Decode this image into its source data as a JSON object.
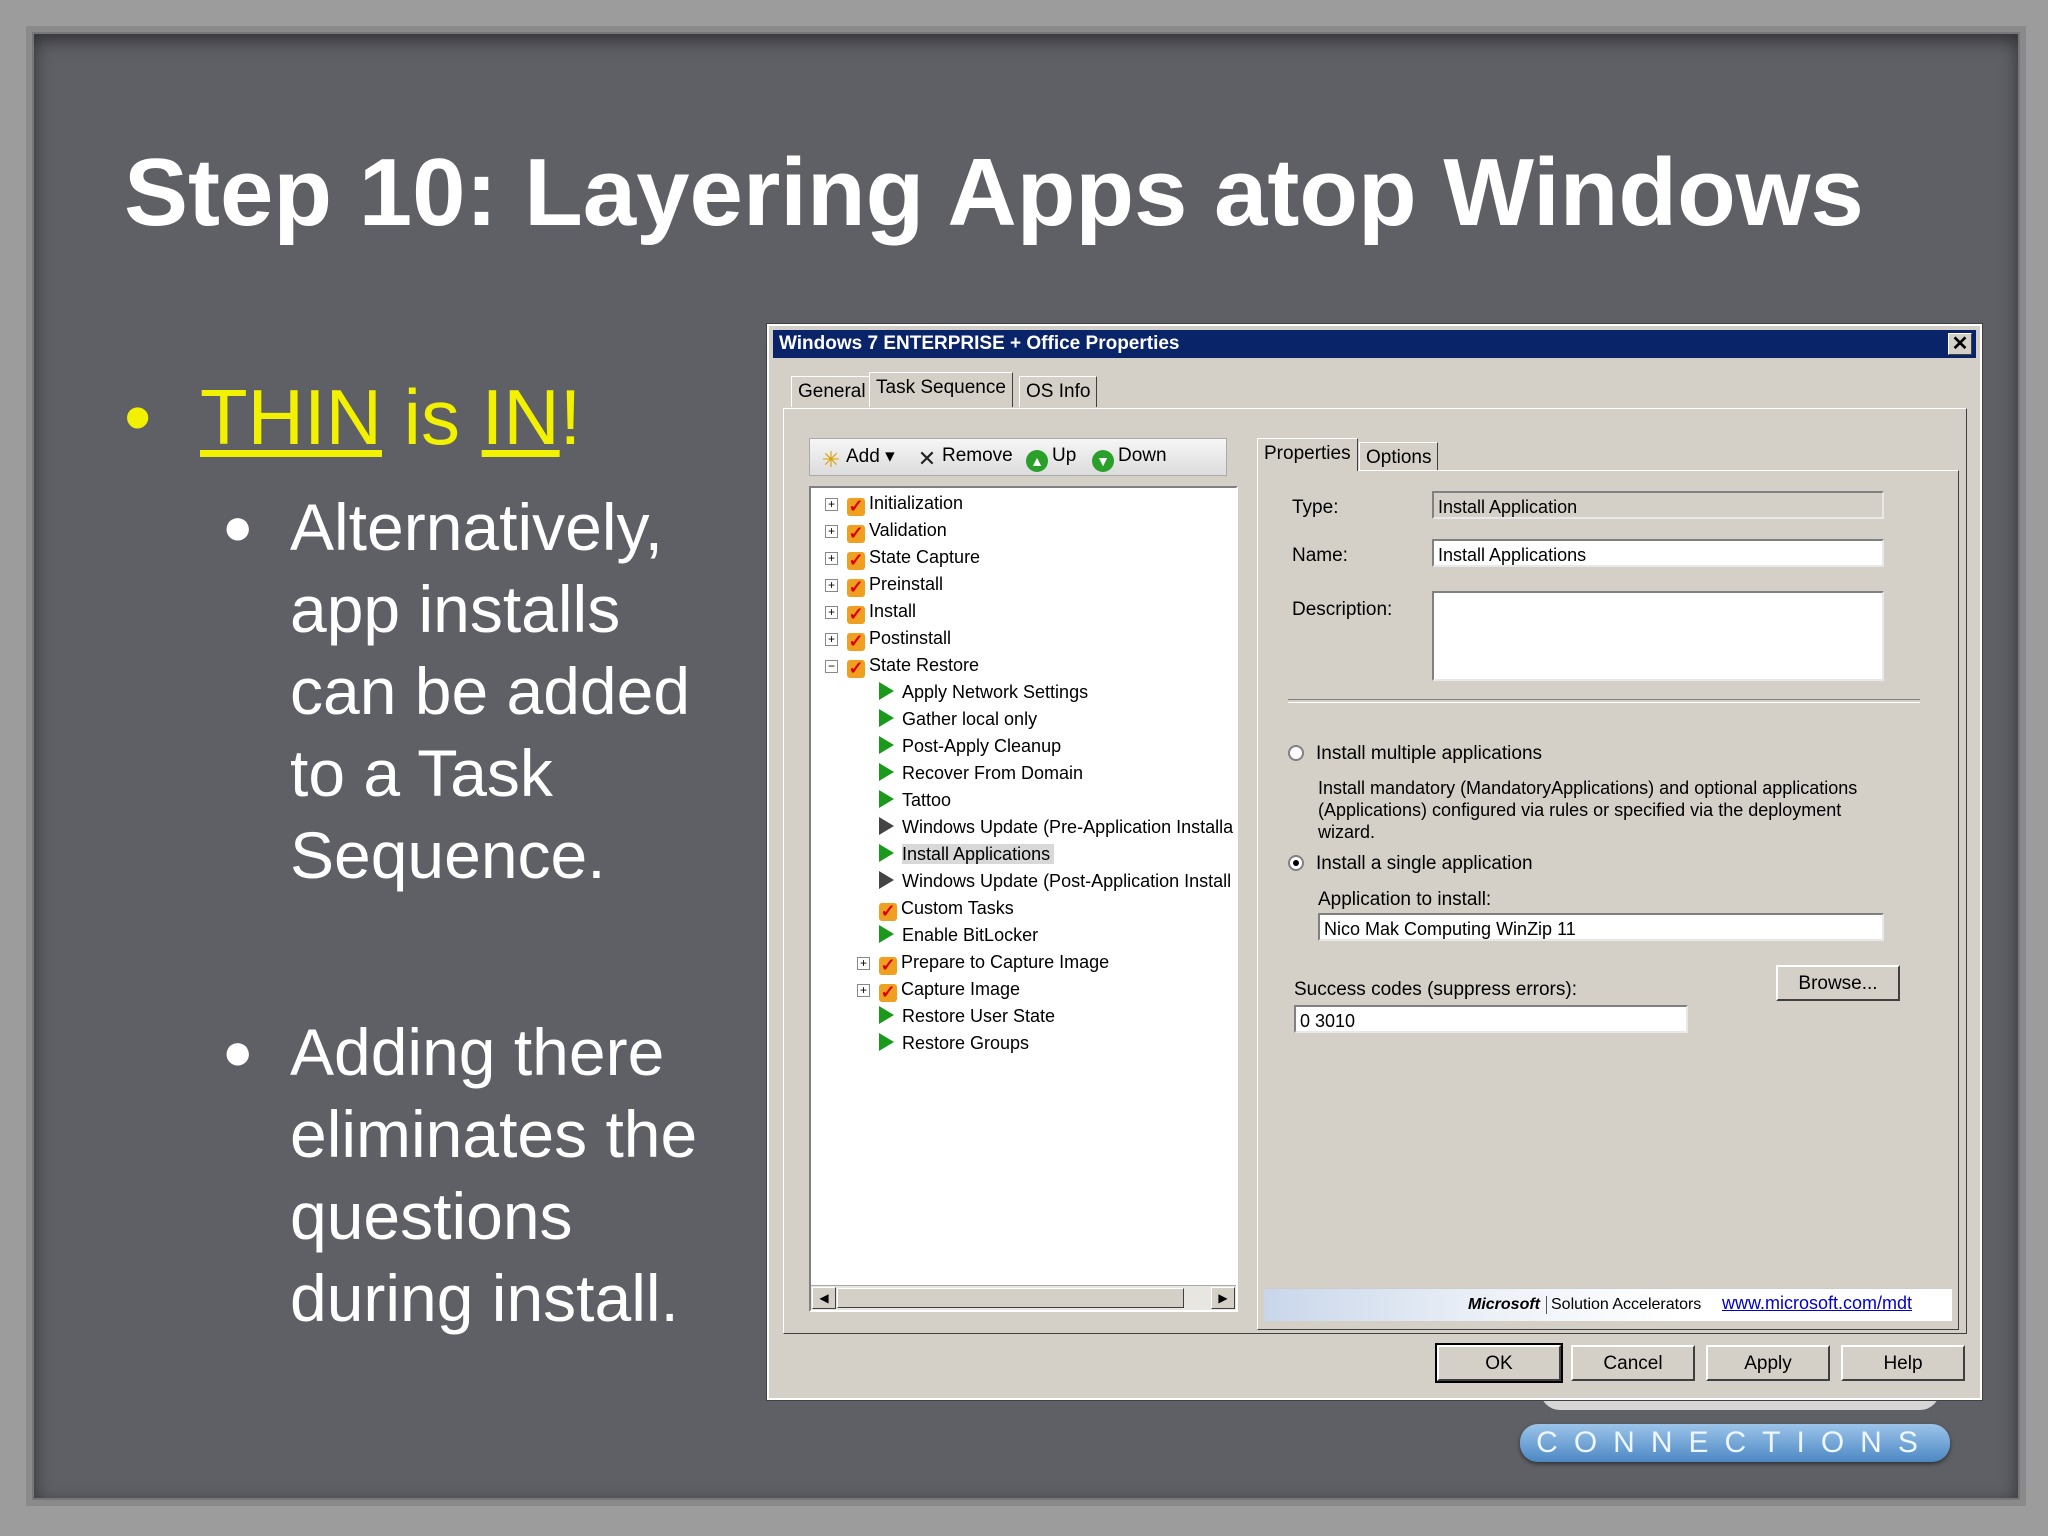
{
  "slide": {
    "title": "Step 10:  Layering Apps atop Windows",
    "bullet1": {
      "part1": "THIN",
      "part2": " is ",
      "part3": "IN",
      "part4": "!"
    },
    "sub1": "Alternatively,\napp installs\ncan be added\nto a Task\nSequence.",
    "sub2": "Adding there\neliminates the\nquestions\nduring install.",
    "logo_text": "CONNECTIONS",
    "colors": {
      "background": "#5f6066",
      "bullet": "#f2f200",
      "text": "#ffffff"
    }
  },
  "dialog": {
    "title": "Windows 7 ENTERPRISE + Office Properties",
    "close": "✕",
    "tabs": [
      "General",
      "Task Sequence",
      "OS Info"
    ],
    "toolbar": {
      "add": "Add",
      "remove": "Remove",
      "up": "Up",
      "down": "Down"
    },
    "tree": {
      "groups": [
        "Initialization",
        "Validation",
        "State Capture",
        "Preinstall",
        "Install",
        "Postinstall",
        "State Restore"
      ],
      "children": [
        "Apply Network Settings",
        "Gather local only",
        "Post-Apply Cleanup",
        "Recover From Domain",
        "Tattoo",
        "Windows Update (Pre-Application Installa",
        "Install Applications",
        "Windows Update (Post-Application Install",
        "Custom Tasks",
        "Enable BitLocker",
        "Prepare to Capture Image",
        "Capture Image",
        "Restore User State",
        "Restore Groups"
      ]
    },
    "props_tabs": [
      "Properties",
      "Options"
    ],
    "type_label": "Type:",
    "type_value": "Install Application",
    "name_label": "Name:",
    "name_value": "Install Applications",
    "description_label": "Description:",
    "description_value": "",
    "radio_multiple": "Install multiple applications",
    "multiple_desc": "Install mandatory (MandatoryApplications) and optional applications (Applications) configured via rules or specified via the deployment wizard.",
    "radio_single": "Install a single application",
    "app_label": "Application to install:",
    "app_value": "Nico Mak Computing WinZip 11",
    "browse": "Browse...",
    "success_label": "Success codes (suppress errors):",
    "success_value": "0 3010",
    "banner_brand": "Microsoft",
    "banner_text": "Solution Accelerators",
    "banner_link": "www.microsoft.com/mdt",
    "buttons": {
      "ok": "OK",
      "cancel": "Cancel",
      "apply": "Apply",
      "help": "Help"
    }
  }
}
